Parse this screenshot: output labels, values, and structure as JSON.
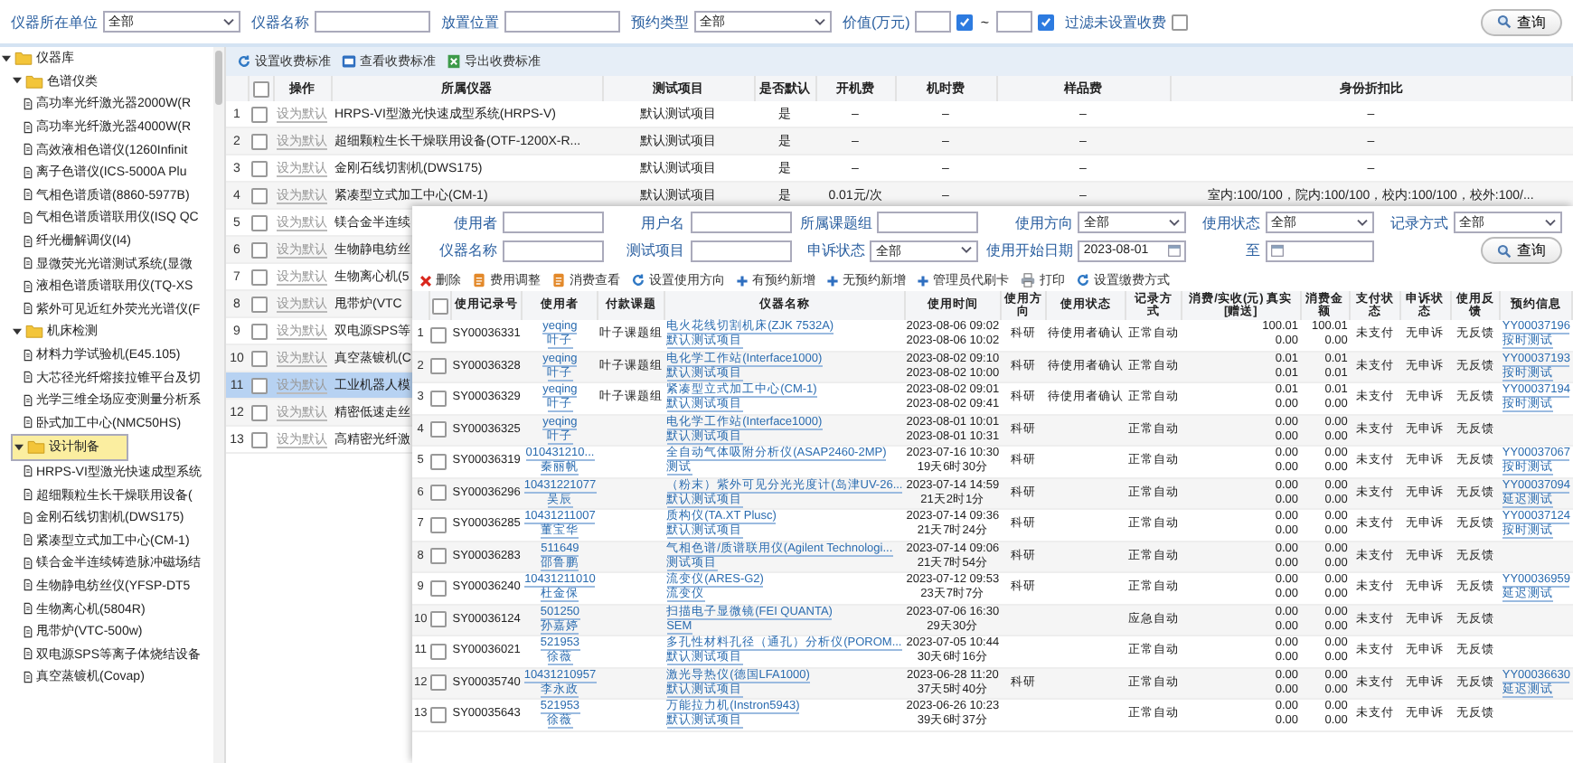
{
  "filter_bar": {
    "fields": [
      {
        "kind": "select",
        "label": "仪器所在单位",
        "value": "全部"
      },
      {
        "kind": "text",
        "label": "仪器名称"
      },
      {
        "kind": "text",
        "label": "放置位置"
      },
      {
        "kind": "select",
        "label": "预约类型",
        "value": "全部"
      },
      {
        "kind": "range",
        "label": "价值(万元)",
        "separator": "~",
        "min_checked": true,
        "max_checked": true
      },
      {
        "kind": "checkbox",
        "label": "过滤未设置收费",
        "checked": false
      }
    ],
    "search_button": "查询"
  },
  "tree": [
    {
      "label": "仪器库",
      "expanded": true,
      "selected": false,
      "children": [
        {
          "label": "色谱仪类",
          "expanded": true,
          "selected": false,
          "children": [
            {
              "label": "高功率光纤激光器2000W(R",
              "selected": false
            },
            {
              "label": "高功率光纤激光器4000W(R",
              "selected": false
            },
            {
              "label": "高效液相色谱仪(1260Infinit",
              "selected": false
            },
            {
              "label": "离子色谱仪(ICS-5000A Plu",
              "selected": false
            },
            {
              "label": "气相色谱质谱(8860-5977B)",
              "selected": false
            },
            {
              "label": "气相色谱质谱联用仪(ISQ QC",
              "selected": false
            },
            {
              "label": "纤光栅解调仪(I4)",
              "selected": false
            },
            {
              "label": "显微荧光光谱测试系统(显微",
              "selected": false
            },
            {
              "label": "液相色谱质谱联用仪(TQ-XS",
              "selected": false
            },
            {
              "label": "紫外可见近红外荧光光谱仪(F",
              "selected": false
            }
          ]
        },
        {
          "label": "机床检测",
          "expanded": true,
          "selected": false,
          "children": [
            {
              "label": "材料力学试验机(E45.105)",
              "selected": false
            },
            {
              "label": "大芯径光纤熔接拉锥平台及切",
              "selected": false
            },
            {
              "label": "光学三维全场应变测量分析系",
              "selected": false
            },
            {
              "label": "卧式加工中心(NMC50HS)",
              "selected": false
            }
          ]
        },
        {
          "label": "设计制备",
          "expanded": true,
          "selected": true,
          "children": [
            {
              "label": "HRPS-VI型激光快速成型系统",
              "selected": false
            },
            {
              "label": "超细颗粒生长干燥联用设备(",
              "selected": false
            },
            {
              "label": "金刚石线切割机(DWS175)",
              "selected": false
            },
            {
              "label": "紧凑型立式加工中心(CM-1)",
              "selected": false
            },
            {
              "label": "镁合金半连续铸造脉冲磁场结",
              "selected": false
            },
            {
              "label": "生物静电纺丝仪(YFSP-DT5",
              "selected": false
            },
            {
              "label": "生物离心机(5804R)",
              "selected": false
            },
            {
              "label": "甩带炉(VTC-500w)",
              "selected": false
            },
            {
              "label": "双电源SPS等离子体烧结设备",
              "selected": false
            },
            {
              "label": "真空蒸镀机(Covap)",
              "selected": false
            }
          ]
        }
      ]
    }
  ],
  "fee_table": {
    "toolbar": [
      {
        "kind": "refresh",
        "label": "设置收费标准"
      },
      {
        "kind": "view",
        "label": "查看收费标准"
      },
      {
        "kind": "export",
        "label": "导出收费标准"
      }
    ],
    "all_checked": false,
    "columns": [
      "操作",
      "所属仪器",
      "测试项目",
      "是否默认",
      "开机费",
      "机时费",
      "样品费",
      "身份折扣比"
    ],
    "rows": [
      {
        "no": "1",
        "checked": false,
        "selected": false,
        "cells": [
          "设为默认",
          "HRPS-VI型激光快速成型系统(HRPS-V)",
          "默认测试项目",
          "是",
          "–",
          "–",
          "–",
          "–"
        ]
      },
      {
        "no": "2",
        "checked": false,
        "selected": false,
        "cells": [
          "设为默认",
          "超细颗粒生长干燥联用设备(OTF-1200X-R...",
          "默认测试项目",
          "是",
          "–",
          "–",
          "–",
          "–"
        ]
      },
      {
        "no": "3",
        "checked": false,
        "selected": false,
        "cells": [
          "设为默认",
          "金刚石线切割机(DWS175)",
          "默认测试项目",
          "是",
          "–",
          "–",
          "–",
          "–"
        ]
      },
      {
        "no": "4",
        "checked": false,
        "selected": false,
        "cells": [
          "设为默认",
          "紧凑型立式加工中心(CM-1)",
          "默认测试项目",
          "是",
          "0.01元/次",
          "–",
          "–",
          "室内:100/100，院内:100/100，校内:100/100，校外:100/..."
        ]
      },
      {
        "no": "5",
        "checked": false,
        "selected": false,
        "cells": [
          "设为默认",
          "镁合金半连续"
        ]
      },
      {
        "no": "6",
        "checked": false,
        "selected": false,
        "cells": [
          "设为默认",
          "生物静电纺丝"
        ]
      },
      {
        "no": "7",
        "checked": false,
        "selected": false,
        "cells": [
          "设为默认",
          "生物离心机(5"
        ]
      },
      {
        "no": "8",
        "checked": false,
        "selected": false,
        "cells": [
          "设为默认",
          "甩带炉(VTC"
        ]
      },
      {
        "no": "9",
        "checked": false,
        "selected": false,
        "cells": [
          "设为默认",
          "双电源SPS等"
        ]
      },
      {
        "no": "10",
        "checked": false,
        "selected": false,
        "cells": [
          "设为默认",
          "真空蒸镀机(C"
        ]
      },
      {
        "no": "11",
        "checked": false,
        "selected": true,
        "cells": [
          "设为默认",
          "工业机器人模"
        ]
      },
      {
        "no": "12",
        "checked": false,
        "selected": false,
        "cells": [
          "设为默认",
          "精密低速走丝"
        ]
      },
      {
        "no": "13",
        "checked": false,
        "selected": false,
        "cells": [
          "设为默认",
          "高精密光纤激"
        ]
      }
    ]
  },
  "usage_panel": {
    "filters": [
      {
        "kind": "text",
        "label": "使用者"
      },
      {
        "kind": "text",
        "label": "用户名"
      },
      {
        "kind": "text",
        "label": "所属课题组"
      },
      {
        "kind": "select",
        "label": "使用方向",
        "value": "全部"
      },
      {
        "kind": "select",
        "label": "使用状态",
        "value": "全部"
      },
      {
        "kind": "select",
        "label": "记录方式",
        "value": "全部"
      },
      {
        "kind": "text",
        "label": "仪器名称"
      },
      {
        "kind": "text",
        "label": "测试项目"
      },
      {
        "kind": "select",
        "label": "申诉状态",
        "value": "全部"
      },
      {
        "kind": "date",
        "label": "使用开始日期",
        "value": "2023-08-01"
      },
      {
        "kind": "date",
        "label": "至"
      }
    ],
    "search_button": "查询",
    "toolbar": [
      {
        "kind": "delete",
        "label": "删除"
      },
      {
        "kind": "document",
        "label": "费用调整"
      },
      {
        "kind": "document",
        "label": "消费查看"
      },
      {
        "kind": "refresh",
        "label": "设置使用方向"
      },
      {
        "kind": "add",
        "label": "有预约新增"
      },
      {
        "kind": "add",
        "label": "无预约新增"
      },
      {
        "kind": "add",
        "label": "管理员代刷卡"
      },
      {
        "kind": "print",
        "label": "打印"
      },
      {
        "kind": "refresh",
        "label": "设置缴费方式"
      }
    ],
    "all_checked": false,
    "columns": [
      "使用记录号",
      "使用者",
      "付款课题",
      "仪器名称",
      "使用时间",
      "使用方向",
      "使用状态",
      "记录方式",
      "消费/实收(元) 真实[赠送]",
      "消费金额",
      "支付状态",
      "申诉状态",
      "使用反馈",
      "预约信息"
    ],
    "rows": [
      {
        "no": "1",
        "checked": false,
        "id": "SY00036331",
        "user": [
          "yeqing",
          "叶子"
        ],
        "payer": "叶子课题组",
        "instrument": "电火花线切割机床(ZJK 7532A)",
        "test_item": "默认测试项目",
        "time": [
          "2023-08-06 09:02",
          "2023-08-06 10:02"
        ],
        "direction": "科研",
        "status": "待使用者确认",
        "record_mode": "正常自动",
        "charge": [
          "100.01",
          "0.00"
        ],
        "amount": [
          "100.01",
          "0.00"
        ],
        "payment": "未支付",
        "appeal": "无申诉",
        "feedback": "无反馈",
        "booking": [
          "YY00037196",
          "按时测试"
        ]
      },
      {
        "no": "2",
        "checked": false,
        "id": "SY00036328",
        "user": [
          "yeqing",
          "叶子"
        ],
        "payer": "叶子课题组",
        "instrument": "电化学工作站(Interface1000)",
        "test_item": "默认测试项目",
        "time": [
          "2023-08-02 09:10",
          "2023-08-02 10:00"
        ],
        "direction": "科研",
        "status": "待使用者确认",
        "record_mode": "正常自动",
        "charge": [
          "0.01",
          "0.01"
        ],
        "amount": [
          "0.01",
          "0.01"
        ],
        "payment": "未支付",
        "appeal": "无申诉",
        "feedback": "无反馈",
        "booking": [
          "YY00037193",
          "按时测试"
        ]
      },
      {
        "no": "3",
        "checked": false,
        "id": "SY00036329",
        "user": [
          "yeqing",
          "叶子"
        ],
        "payer": "叶子课题组",
        "instrument": "紧凑型立式加工中心(CM-1)",
        "test_item": "默认测试项目",
        "time": [
          "2023-08-02 09:01",
          "2023-08-02 09:41"
        ],
        "direction": "科研",
        "status": "待使用者确认",
        "record_mode": "正常自动",
        "charge": [
          "0.01",
          "0.00"
        ],
        "amount": [
          "0.01",
          "0.00"
        ],
        "payment": "未支付",
        "appeal": "无申诉",
        "feedback": "无反馈",
        "booking": [
          "YY00037194",
          "按时测试"
        ]
      },
      {
        "no": "4",
        "checked": false,
        "id": "SY00036325",
        "user": [
          "yeqing",
          "叶子"
        ],
        "instrument": "电化学工作站(Interface1000)",
        "test_item": "默认测试项目",
        "time": [
          "2023-08-01 10:01",
          "2023-08-01 10:31"
        ],
        "direction": "科研",
        "record_mode": "正常自动",
        "charge": [
          "0.00",
          "0.00"
        ],
        "amount": [
          "0.00",
          "0.00"
        ],
        "payment": "未支付",
        "appeal": "无申诉",
        "feedback": "无反馈"
      },
      {
        "no": "5",
        "checked": false,
        "id": "SY00036319",
        "user": [
          "010431210...",
          "秦丽帆"
        ],
        "instrument": "全自动气体吸附分析仪(ASAP2460-2MP)",
        "test_item": "测试",
        "time": [
          "2023-07-16 10:30",
          "19天6时30分"
        ],
        "direction": "科研",
        "record_mode": "正常自动",
        "charge": [
          "0.00",
          "0.00"
        ],
        "amount": [
          "0.00",
          "0.00"
        ],
        "payment": "未支付",
        "appeal": "无申诉",
        "feedback": "无反馈",
        "booking": [
          "YY00037067",
          "按时测试"
        ]
      },
      {
        "no": "6",
        "checked": false,
        "id": "SY00036296",
        "user": [
          "10431221077",
          "吴辰"
        ],
        "instrument": "（粉末）紫外可见分光光度计(岛津UV-26...",
        "test_item": "默认测试项目",
        "time": [
          "2023-07-14 14:59",
          "21天2时1分"
        ],
        "direction": "科研",
        "record_mode": "正常自动",
        "charge": [
          "0.00",
          "0.00"
        ],
        "amount": [
          "0.00",
          "0.00"
        ],
        "payment": "未支付",
        "appeal": "无申诉",
        "feedback": "无反馈",
        "booking": [
          "YY00037094",
          "延迟测试"
        ]
      },
      {
        "no": "7",
        "checked": false,
        "id": "SY00036285",
        "user": [
          "10431211007",
          "董宝华"
        ],
        "instrument": "质构仪(TA.XT Plusc)",
        "test_item": "默认测试项目",
        "time": [
          "2023-07-14 09:36",
          "21天7时24分"
        ],
        "direction": "科研",
        "record_mode": "正常自动",
        "charge": [
          "0.00",
          "0.00"
        ],
        "amount": [
          "0.00",
          "0.00"
        ],
        "payment": "未支付",
        "appeal": "无申诉",
        "feedback": "无反馈",
        "booking": [
          "YY00037124",
          "按时测试"
        ]
      },
      {
        "no": "8",
        "checked": false,
        "id": "SY00036283",
        "user": [
          "511649",
          "邵鲁鹏"
        ],
        "instrument": "气相色谱/质谱联用仪(Agilent Technologi...",
        "test_item": "测试项目",
        "time": [
          "2023-07-14 09:06",
          "21天7时54分"
        ],
        "direction": "科研",
        "record_mode": "正常自动",
        "charge": [
          "0.00",
          "0.00"
        ],
        "amount": [
          "0.00",
          "0.00"
        ],
        "payment": "未支付",
        "appeal": "无申诉",
        "feedback": "无反馈"
      },
      {
        "no": "9",
        "checked": false,
        "id": "SY00036240",
        "user": [
          "10431211010",
          "杜金保"
        ],
        "instrument": "流变仪(ARES-G2)",
        "test_item": "流变仪",
        "time": [
          "2023-07-12 09:53",
          "23天7时7分"
        ],
        "direction": "科研",
        "record_mode": "正常自动",
        "charge": [
          "0.00",
          "0.00"
        ],
        "amount": [
          "0.00",
          "0.00"
        ],
        "payment": "未支付",
        "appeal": "无申诉",
        "feedback": "无反馈",
        "booking": [
          "YY00036959",
          "延迟测试"
        ]
      },
      {
        "no": "10",
        "checked": false,
        "id": "SY00036124",
        "user": [
          "501250",
          "孙嘉婷"
        ],
        "instrument": "扫描电子显微镜(FEI QUANTA)",
        "test_item": "SEM",
        "time": [
          "2023-07-06 16:30",
          "29天30分"
        ],
        "record_mode": "应急自动",
        "charge": [
          "0.00",
          "0.00"
        ],
        "amount": [
          "0.00",
          "0.00"
        ],
        "payment": "未支付",
        "appeal": "无申诉",
        "feedback": "无反馈"
      },
      {
        "no": "11",
        "checked": false,
        "id": "SY00036021",
        "user": [
          "521953",
          "徐薇"
        ],
        "instrument": "多孔性材料孔径（通孔）分析仪(POROM...",
        "test_item": "默认测试项目",
        "time": [
          "2023-07-05 10:44",
          "30天6时16分"
        ],
        "record_mode": "正常自动",
        "charge": [
          "0.00",
          "0.00"
        ],
        "amount": [
          "0.00",
          "0.00"
        ],
        "payment": "未支付",
        "appeal": "无申诉",
        "feedback": "无反馈"
      },
      {
        "no": "12",
        "checked": false,
        "id": "SY00035740",
        "user": [
          "10431210957",
          "李永政"
        ],
        "instrument": "激光导热仪(德国LFA1000)",
        "test_item": "默认测试项目",
        "time": [
          "2023-06-28 11:20",
          "37天5时40分"
        ],
        "direction": "科研",
        "record_mode": "正常自动",
        "charge": [
          "0.00",
          "0.00"
        ],
        "amount": [
          "0.00",
          "0.00"
        ],
        "payment": "未支付",
        "appeal": "无申诉",
        "feedback": "无反馈",
        "booking": [
          "YY00036630",
          "延迟测试"
        ]
      },
      {
        "no": "13",
        "checked": false,
        "id": "SY00035643",
        "user": [
          "521953",
          "徐薇"
        ],
        "instrument": "万能拉力机(Instron5943)",
        "test_item": "默认测试项目",
        "time": [
          "2023-06-26 10:23",
          "39天6时37分"
        ],
        "record_mode": "正常自动",
        "charge": [
          "0.00",
          "0.00"
        ],
        "amount": [
          "0.00",
          "0.00"
        ],
        "payment": "未支付",
        "appeal": "无申诉",
        "feedback": "无反馈"
      }
    ]
  }
}
